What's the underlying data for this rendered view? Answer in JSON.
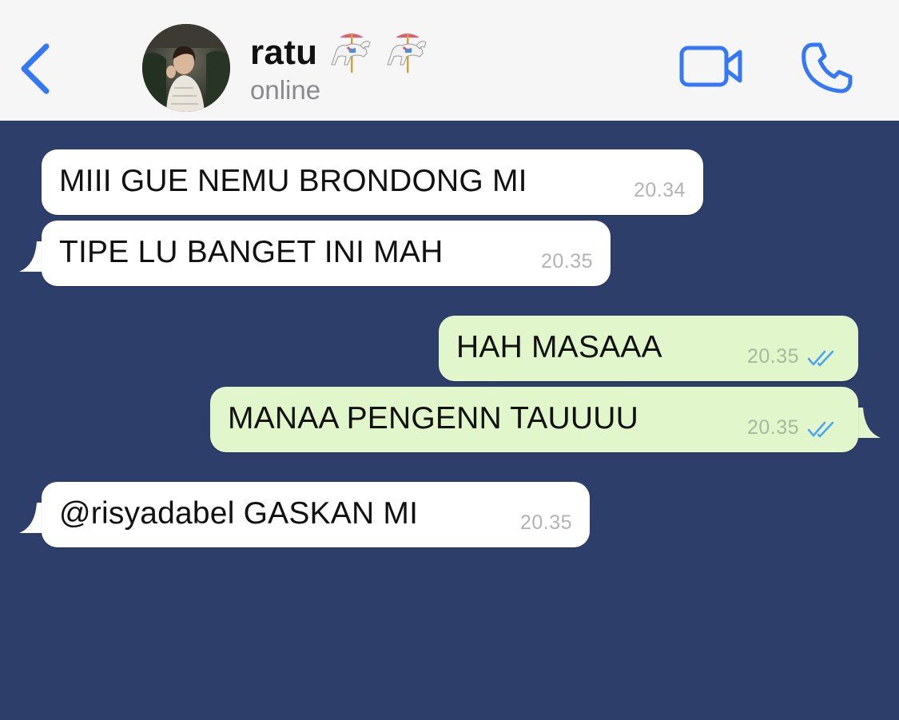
{
  "header": {
    "contact_name": "ratu",
    "emoji_icons": [
      "carousel-horse-icon",
      "carousel-horse-icon"
    ],
    "status": "online",
    "accent_color": "#3478f6"
  },
  "chat": {
    "background_color": "#2d3e6b",
    "messages": [
      {
        "direction": "incoming",
        "text": "MIII GUE NEMU BRONDONG MI",
        "time": "20.34"
      },
      {
        "direction": "incoming",
        "text": "TIPE LU BANGET INI MAH",
        "time": "20.35"
      },
      {
        "direction": "outgoing",
        "text": "HAH MASAAA",
        "time": "20.35",
        "read": true
      },
      {
        "direction": "outgoing",
        "text": "MANAA PENGENN TAUUUU",
        "time": "20.35",
        "read": true
      },
      {
        "direction": "incoming",
        "text": "@risyadabel GASKAN MI",
        "time": "20.35"
      }
    ]
  }
}
